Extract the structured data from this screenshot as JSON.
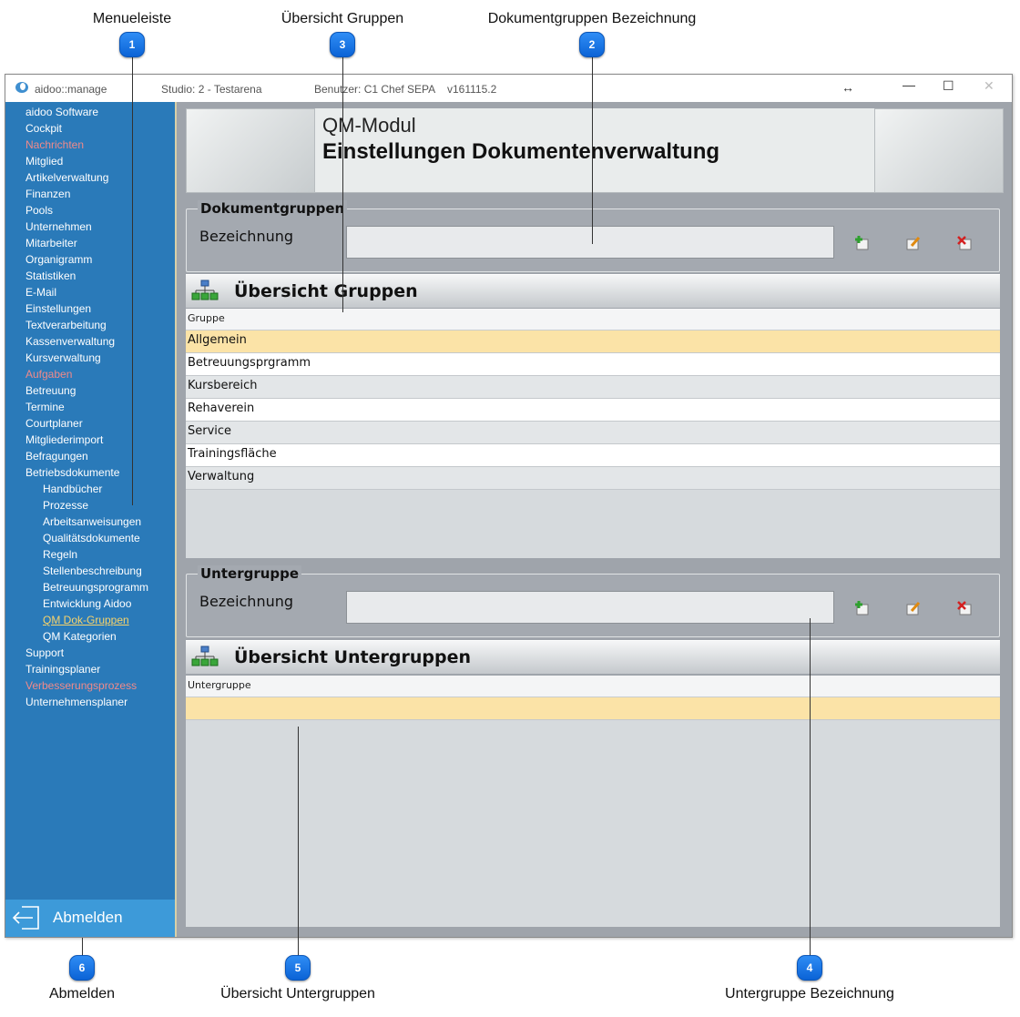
{
  "callouts": [
    {
      "num": "1",
      "label": "Menueleiste"
    },
    {
      "num": "2",
      "label": "Dokumentgruppen Bezeichnung"
    },
    {
      "num": "3",
      "label": "Übersicht Gruppen"
    },
    {
      "num": "4",
      "label": "Untergruppe Bezeichnung"
    },
    {
      "num": "5",
      "label": "Übersicht Untergruppen"
    },
    {
      "num": "6",
      "label": "Abmelden"
    }
  ],
  "titlebar": {
    "app": "aidoo::manage",
    "studio": "Studio: 2 - Testarena",
    "user": "Benutzer: C1 Chef   SEPA",
    "version": "v161115.2"
  },
  "menu": [
    {
      "label": "aidoo Software",
      "style": "normal"
    },
    {
      "label": "Cockpit",
      "style": "normal"
    },
    {
      "label": "Nachrichten",
      "style": "red"
    },
    {
      "label": "Mitglied",
      "style": "normal"
    },
    {
      "label": "Artikelverwaltung",
      "style": "normal"
    },
    {
      "label": "Finanzen",
      "style": "normal"
    },
    {
      "label": "Pools",
      "style": "normal"
    },
    {
      "label": "Unternehmen",
      "style": "normal"
    },
    {
      "label": "Mitarbeiter",
      "style": "normal"
    },
    {
      "label": "Organigramm",
      "style": "normal"
    },
    {
      "label": "Statistiken",
      "style": "normal"
    },
    {
      "label": "E-Mail",
      "style": "normal"
    },
    {
      "label": "Einstellungen",
      "style": "normal"
    },
    {
      "label": "Textverarbeitung",
      "style": "normal"
    },
    {
      "label": "Kassenverwaltung",
      "style": "normal"
    },
    {
      "label": "Kursverwaltung",
      "style": "normal"
    },
    {
      "label": "Aufgaben",
      "style": "red"
    },
    {
      "label": "Betreuung",
      "style": "normal"
    },
    {
      "label": "Termine",
      "style": "normal"
    },
    {
      "label": "Courtplaner",
      "style": "normal"
    },
    {
      "label": "Mitgliederimport",
      "style": "normal"
    },
    {
      "label": "Befragungen",
      "style": "normal"
    },
    {
      "label": "Betriebsdokumente",
      "style": "normal"
    },
    {
      "label": "Handbücher",
      "style": "sub"
    },
    {
      "label": "Prozesse",
      "style": "sub"
    },
    {
      "label": "Arbeitsanweisungen",
      "style": "sub"
    },
    {
      "label": "Qualitätsdokumente",
      "style": "sub"
    },
    {
      "label": "Regeln",
      "style": "sub"
    },
    {
      "label": "Stellenbeschreibung",
      "style": "sub"
    },
    {
      "label": "Betreuungsprogramm",
      "style": "sub"
    },
    {
      "label": "Entwicklung Aidoo",
      "style": "sub"
    },
    {
      "label": "QM Dok-Gruppen",
      "style": "sub-active"
    },
    {
      "label": "QM Kategorien",
      "style": "sub"
    },
    {
      "label": "Support",
      "style": "normal"
    },
    {
      "label": "Trainingsplaner",
      "style": "normal"
    },
    {
      "label": "Verbesserungsprozess",
      "style": "red"
    },
    {
      "label": "Unternehmensplaner",
      "style": "normal"
    }
  ],
  "logout": {
    "label": "Abmelden"
  },
  "header": {
    "line1": "QM-Modul",
    "line2": "Einstellungen Dokumentenverwaltung"
  },
  "doc_groups": {
    "title": "Dokumentgruppen",
    "field_label": "Bezeichnung",
    "field_value": ""
  },
  "groups_overview": {
    "title": "Übersicht Gruppen",
    "column": "Gruppe",
    "rows": [
      "Allgemein",
      "Betreuungsprgramm",
      "Kursbereich",
      "Rehaverein",
      "Service",
      "Trainingsfläche",
      "Verwaltung"
    ],
    "selected_index": 0
  },
  "subgroup": {
    "title": "Untergruppe",
    "field_label": "Bezeichnung",
    "field_value": ""
  },
  "subgroups_overview": {
    "title": "Übersicht Untergruppen",
    "column": "Untergruppe",
    "rows": [
      ""
    ]
  },
  "colors": {
    "sidebar": "#2a7ab9",
    "logout": "#3d9ad9",
    "selected_row": "#fbe3a7",
    "menu_red": "#f08a8a",
    "menu_active": "#f7d36b",
    "marker": "#1a74e8"
  }
}
